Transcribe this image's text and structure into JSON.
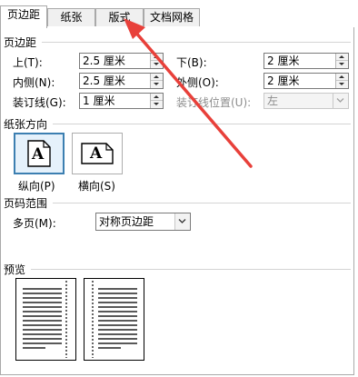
{
  "tabs": [
    {
      "label": "页边距"
    },
    {
      "label": "纸张"
    },
    {
      "label": "版式"
    },
    {
      "label": "文档网格"
    }
  ],
  "margins": {
    "section_title": "页边距",
    "top_label": "上(T):",
    "top_value": "2.5 厘米",
    "bottom_label": "下(B):",
    "bottom_value": "2 厘米",
    "inside_label": "内侧(N):",
    "inside_value": "2.5 厘米",
    "outside_label": "外侧(O):",
    "outside_value": "2 厘米",
    "gutter_label": "装订线(G):",
    "gutter_value": "1 厘米",
    "gutter_position_label": "装订线位置(U):",
    "gutter_position_value": "左"
  },
  "orientation": {
    "section_title": "纸张方向",
    "portrait_icon_letter": "A",
    "portrait_label": "纵向(P)",
    "landscape_icon_letter": "A",
    "landscape_label": "横向(S)"
  },
  "pages": {
    "section_title": "页码范围",
    "multiple_label": "多页(M):",
    "multiple_value": "对称页边距"
  },
  "preview": {
    "section_title": "预览"
  },
  "colors": {
    "annotation_arrow": "#e8403a",
    "selected_border": "#3c7fb1",
    "selected_fill": "#e5f1fb"
  }
}
